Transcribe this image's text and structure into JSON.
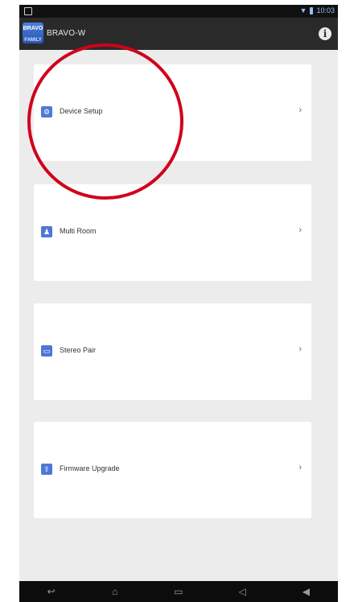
{
  "status_bar": {
    "time": "10:03"
  },
  "action_bar": {
    "logo_line1": "BRAVO",
    "logo_line2": "FAMILY",
    "title": "BRAVO-W",
    "info_icon": "info-icon"
  },
  "menu": [
    {
      "label": "Device Setup",
      "icon": "gear-icon",
      "chevron": "›"
    },
    {
      "label": "Multi Room",
      "icon": "people-icon",
      "chevron": "›"
    },
    {
      "label": "Stereo Pair",
      "icon": "speaker-pair-icon",
      "chevron": "›"
    },
    {
      "label": "Firmware Upgrade",
      "icon": "upload-icon",
      "chevron": "›"
    }
  ],
  "nav_bar": {
    "buttons": [
      "back",
      "home",
      "recent-apps",
      "volume-down",
      "volume-up"
    ]
  },
  "colors": {
    "action_bar": "#2a2a2a",
    "accent": "#4f78d6",
    "annotation": "#d0021b",
    "background": "#ececec"
  }
}
